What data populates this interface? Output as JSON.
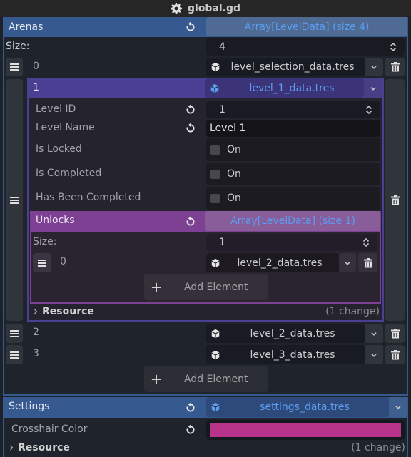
{
  "window": {
    "title": "global.gd",
    "title_icon": "gear-icon"
  },
  "arenas": {
    "label": "Arenas",
    "type_value": "Array[LevelData] (size 4)",
    "size_label": "Size:",
    "size_value": "4",
    "items": [
      {
        "index": "0",
        "resource": "level_selection_data.tres"
      },
      {
        "index": "1",
        "resource": "level_1_data.tres",
        "properties": {
          "level_id": {
            "label": "Level ID",
            "value": "1"
          },
          "level_name": {
            "label": "Level Name",
            "value": "Level 1"
          },
          "is_locked": {
            "label": "Is Locked",
            "toggle_label": "On",
            "checked": false
          },
          "is_completed": {
            "label": "Is Completed",
            "toggle_label": "On",
            "checked": false
          },
          "has_been_completed": {
            "label": "Has Been Completed",
            "toggle_label": "On",
            "checked": false
          }
        },
        "unlocks": {
          "label": "Unlocks",
          "type_value": "Array[LevelData] (size 1)",
          "size_label": "Size:",
          "size_value": "1",
          "items": [
            {
              "index": "0",
              "resource": "level_2_data.tres"
            }
          ],
          "add_element_label": "Add Element"
        },
        "resource_section": {
          "label": "Resource",
          "changes": "(1 change)"
        }
      },
      {
        "index": "2",
        "resource": "level_2_data.tres"
      },
      {
        "index": "3",
        "resource": "level_3_data.tres"
      }
    ],
    "add_element_label": "Add Element"
  },
  "settings": {
    "label": "Settings",
    "resource": "settings_data.tres",
    "crosshair_color": {
      "label": "Crosshair Color",
      "value": "#b8348a"
    },
    "resource_section": {
      "label": "Resource",
      "changes": "(1 change)"
    }
  },
  "colors": {
    "accent_blue": "#36598f",
    "accent_purple": "#4b3f94",
    "accent_magenta": "#7d4093",
    "link_blue": "#5d9cf0"
  }
}
